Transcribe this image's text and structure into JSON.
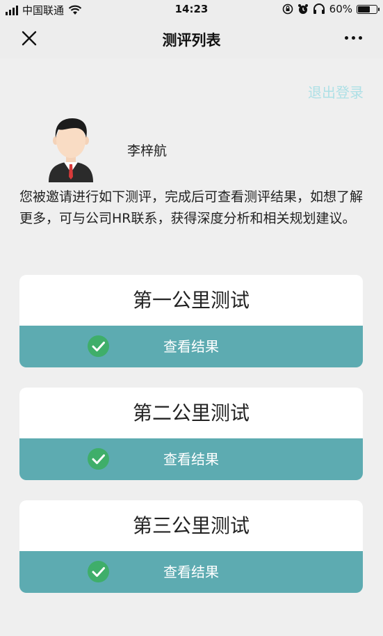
{
  "status_bar": {
    "carrier": "中国联通",
    "time": "14:23",
    "battery": "60%",
    "battery_level": 0.6
  },
  "nav": {
    "title": "测评列表"
  },
  "header": {
    "logout_label": "退出登录",
    "username": "李梓航",
    "intro": "您被邀请进行如下测评，完成后可查看测评结果，如想了解更多，可与公司HR联系，获得深度分析和相关规划建议。"
  },
  "tests": [
    {
      "title": "第一公里测试",
      "button_label": "查看结果"
    },
    {
      "title": "第二公里测试",
      "button_label": "查看结果"
    },
    {
      "title": "第三公里测试",
      "button_label": "查看结果"
    }
  ],
  "colors": {
    "accent": "#5dabb1",
    "check": "#3fae6a",
    "logout": "#aee0e6",
    "background": "#efefef"
  }
}
